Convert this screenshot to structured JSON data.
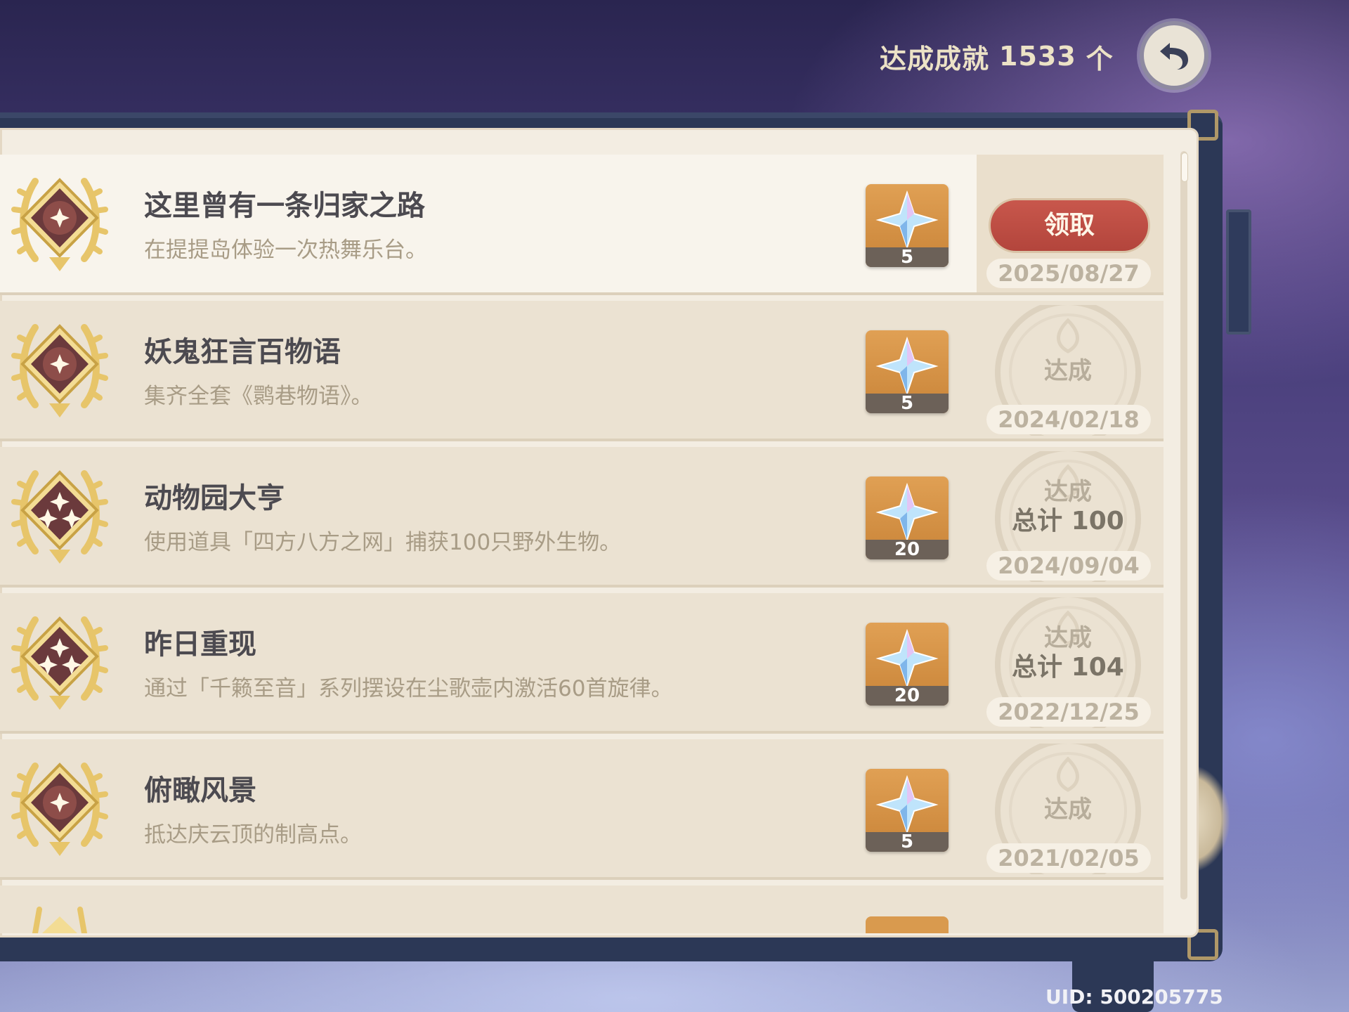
{
  "header": {
    "achievement_label": "达成成就",
    "achievement_count": "1533",
    "achievement_unit": "个"
  },
  "achievements": [
    {
      "title": "这里曾有一条归家之路",
      "description": "在提提岛体验一次热舞乐台。",
      "reward_qty": "5",
      "state": "claimable",
      "button_label": "领取",
      "date": "2025/08/27",
      "stars": 1
    },
    {
      "title": "妖鬼狂言百物语",
      "description": "集齐全套《鹮巷物语》。",
      "reward_qty": "5",
      "state": "achieved",
      "status_label": "达成",
      "total": "",
      "date": "2024/02/18",
      "stars": 1
    },
    {
      "title": "动物园大亨",
      "description": "使用道具「四方八方之网」捕获100只野外生物。",
      "reward_qty": "20",
      "state": "achieved",
      "status_label": "达成",
      "total": "总计 100",
      "date": "2024/09/04",
      "stars": 3
    },
    {
      "title": "昨日重现",
      "description": "通过「千籁至音」系列摆设在尘歌壶内激活60首旋律。",
      "reward_qty": "20",
      "state": "achieved",
      "status_label": "达成",
      "total": "总计 104",
      "date": "2022/12/25",
      "stars": 3
    },
    {
      "title": "俯瞰风景",
      "description": "抵达庆云顶的制高点。",
      "reward_qty": "5",
      "state": "achieved",
      "status_label": "达成",
      "total": "",
      "date": "2021/02/05",
      "stars": 1
    }
  ],
  "footer": {
    "uid": "UID: 500205775"
  },
  "colors": {
    "claim_button": "#b9493f",
    "paper": "#f3ede2",
    "frame": "#2c3856"
  }
}
